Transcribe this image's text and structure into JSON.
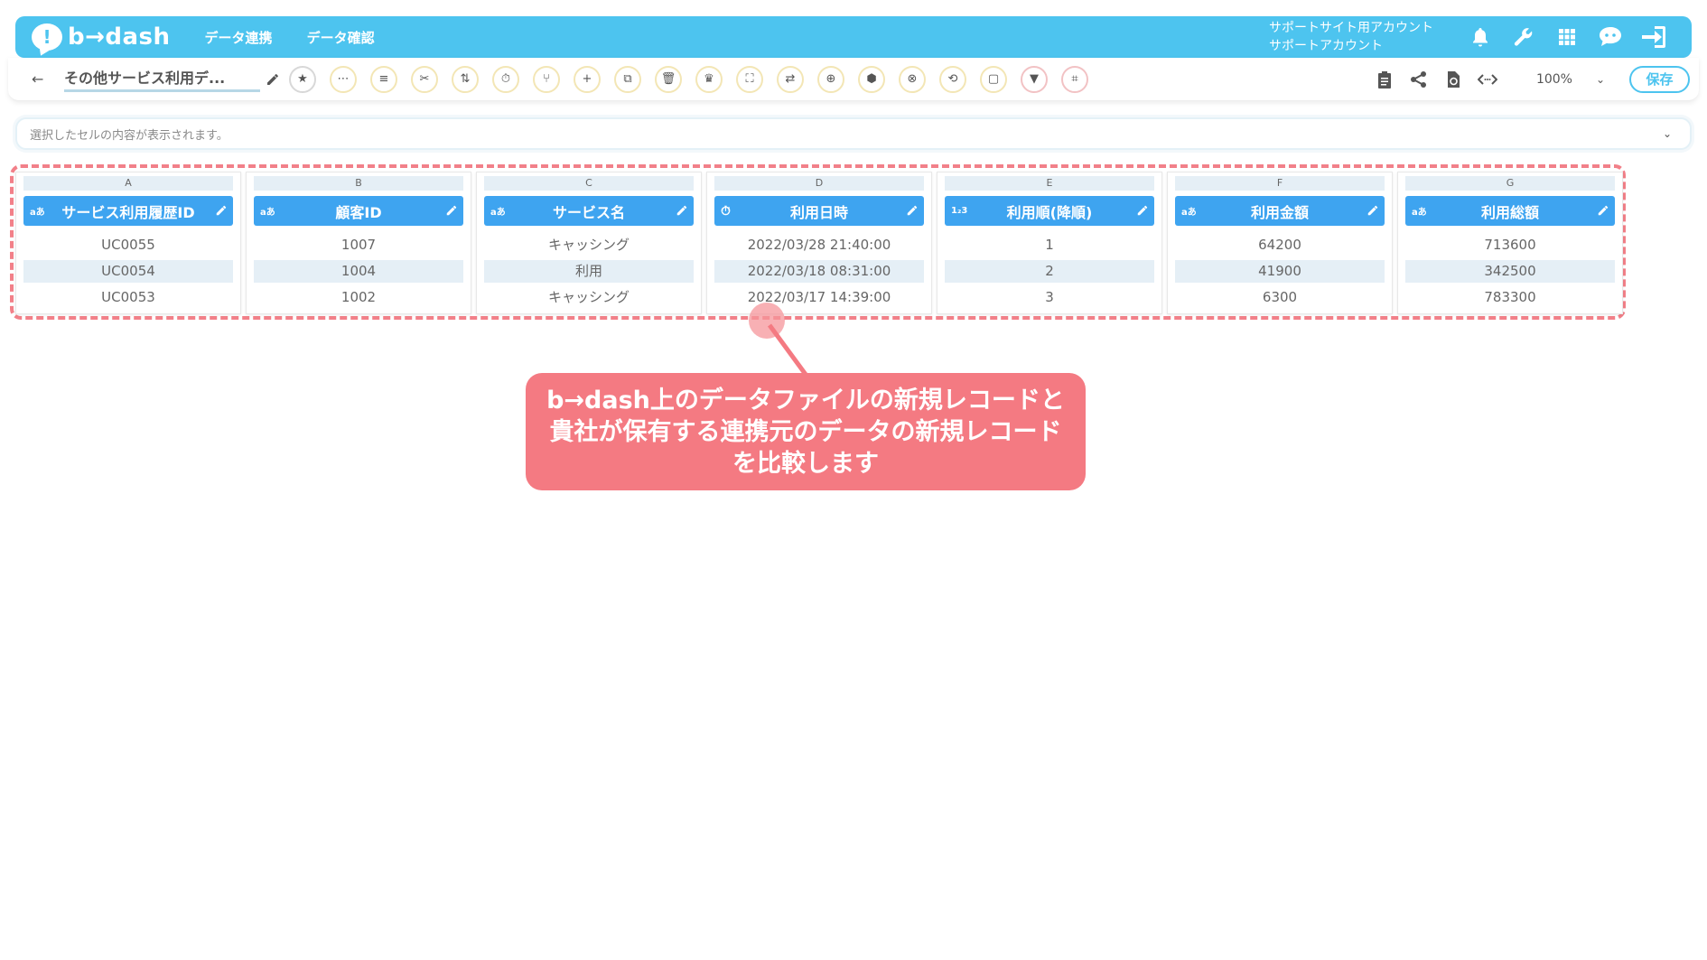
{
  "header": {
    "logo_text": "b→dash",
    "logo_mark": "!",
    "nav": [
      "データ連携",
      "データ確認"
    ],
    "account_line1": "サポートサイト用アカウント",
    "account_line2": "サポートアカウント",
    "icons": [
      "bell-icon",
      "wrench-icon",
      "grid-icon",
      "chat-bot-icon",
      "logout-icon"
    ]
  },
  "toolbar": {
    "back": "←",
    "file_title": "その他サービス利用デ...",
    "zoom": "100%",
    "zoom_chevron": "⌄",
    "save_label": "保存",
    "tools": [
      "★",
      "⋯",
      "≡",
      "✂",
      "⇅",
      "⏱",
      "⑂",
      "+",
      "⧉",
      "🗑",
      "♛",
      "⛶",
      "⇄",
      "⊕",
      "⬢",
      "⊗",
      "⟲",
      "▢",
      "▼",
      "⌗"
    ]
  },
  "cellbar": {
    "placeholder": "選択したセルの内容が表示されます。",
    "chevron": "⌄"
  },
  "table": {
    "columns": [
      {
        "letter": "A",
        "type": "aあ",
        "name": "サービス利用履歴ID",
        "rows": [
          "UC0055",
          "UC0054",
          "UC0053"
        ]
      },
      {
        "letter": "B",
        "type": "aあ",
        "name": "顧客ID",
        "rows": [
          "1007",
          "1004",
          "1002"
        ]
      },
      {
        "letter": "C",
        "type": "aあ",
        "name": "サービス名",
        "rows": [
          "キャッシング",
          "利用",
          "キャッシング"
        ]
      },
      {
        "letter": "D",
        "type": "⏱",
        "name": "利用日時",
        "rows": [
          "2022/03/28 21:40:00",
          "2022/03/18 08:31:00",
          "2022/03/17 14:39:00"
        ]
      },
      {
        "letter": "E",
        "type": "1₂3",
        "name": "利用順(降順)",
        "rows": [
          "1",
          "2",
          "3"
        ]
      },
      {
        "letter": "F",
        "type": "aあ",
        "name": "利用金額",
        "rows": [
          "64200",
          "41900",
          "6300"
        ]
      },
      {
        "letter": "G",
        "type": "aあ",
        "name": "利用総額",
        "rows": [
          "713600",
          "342500",
          "783300"
        ]
      }
    ]
  },
  "callout": {
    "line1": "b→dash上のデータファイルの新規レコードと",
    "line2": "貴社が保有する連携元のデータの新規レコード",
    "line3": "を比較します"
  },
  "colors": {
    "header_bg": "#4dc4ef",
    "column_header": "#3ea4f0",
    "highlight_dashed": "#f28089",
    "callout_bg": "#f47a82"
  }
}
